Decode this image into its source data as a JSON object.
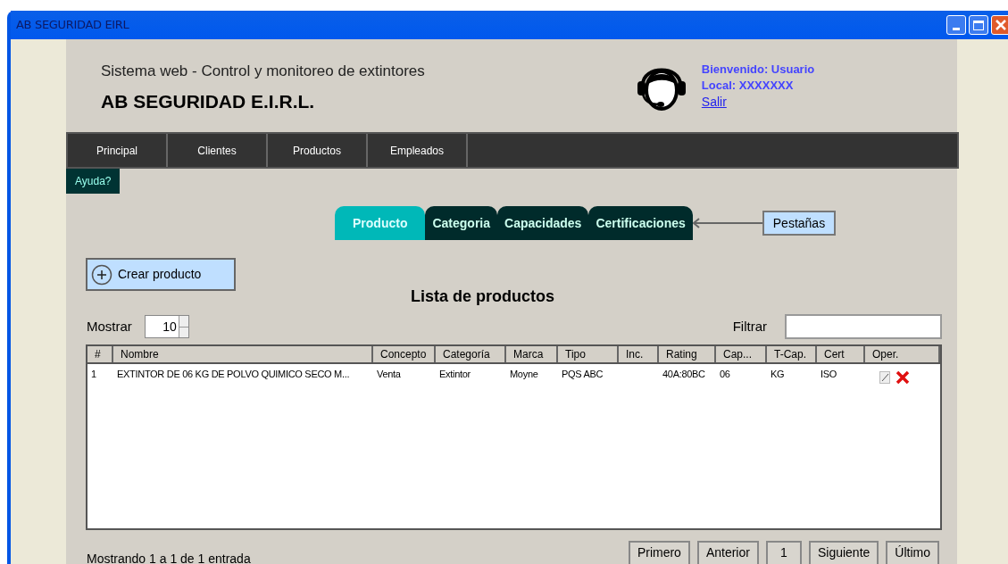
{
  "window": {
    "title": "AB SEGURIDAD EIRL"
  },
  "header": {
    "subtitle": "Sistema web - Control y monitoreo de extintores",
    "company": "AB SEGURIDAD E.I.R.L.",
    "welcome": "Bienvenido: Usuario",
    "local": "Local: XXXXXXX",
    "logout": "Salir"
  },
  "nav": [
    "Principal",
    "Clientes",
    "Productos",
    "Empleados"
  ],
  "help": "Ayuda?",
  "tabs": [
    {
      "label": "Producto",
      "selected": true
    },
    {
      "label": "Categoria",
      "selected": false
    },
    {
      "label": "Capacidades",
      "selected": false
    },
    {
      "label": "Certificaciones",
      "selected": false
    }
  ],
  "callout": "Pestañas",
  "create_button": "Crear producto",
  "list_title": "Lista de productos",
  "show": {
    "label": "Mostrar",
    "value": "10"
  },
  "filter": {
    "label": "Filtrar"
  },
  "table": {
    "columns": [
      "#",
      "Nombre",
      "Concepto",
      "Categoría",
      "Marca",
      "Tipo",
      "Inc.",
      "Rating",
      "Cap...",
      "T-Cap.",
      "Cert",
      "Oper."
    ],
    "rows": [
      [
        "1",
        "EXTINTOR DE 06 KG DE POLVO QUIMICO SECO M...",
        "Venta",
        "Extintor",
        "Moyne",
        "PQS ABC",
        "",
        "40A:80BC",
        "06",
        "KG",
        "ISO"
      ]
    ]
  },
  "status": "Mostrando 1 a 1 de 1 entrada",
  "pagination": [
    {
      "label": "Primero",
      "kind": "nav"
    },
    {
      "label": "Anterior",
      "kind": "nav"
    },
    {
      "label": "1",
      "kind": "page"
    },
    {
      "label": "Siguiente",
      "kind": "nav"
    },
    {
      "label": "Último",
      "kind": "nav"
    }
  ]
}
